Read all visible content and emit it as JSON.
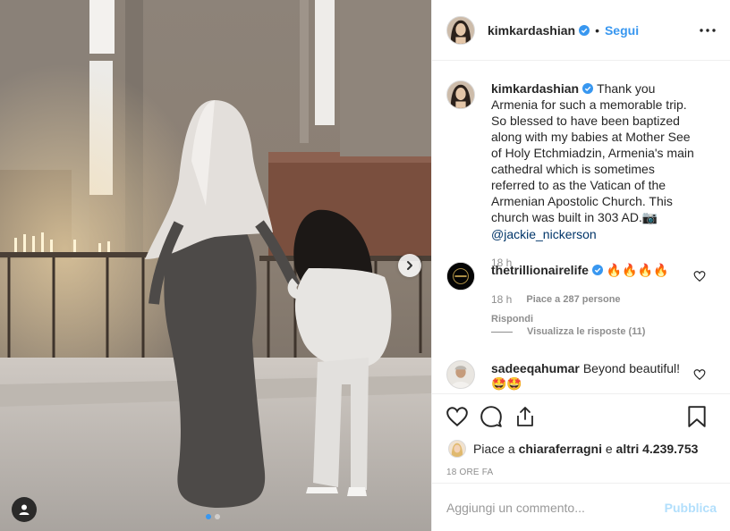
{
  "post": {
    "author": "kimkardashian",
    "separator": "•",
    "follow_label": "Segui",
    "carousel_total": 2,
    "carousel_active": 1
  },
  "caption": {
    "username": "kimkardashian",
    "text": "Thank you Armenia for such a memorable trip. So blessed to have been baptized along with my babies at Mother See of Holy Etchmiadzin, Armenia's main cathedral which is sometimes referred to as the Vatican of the Armenian Apostolic Church. This church was built in 303 AD.",
    "camera_emoji": "📷",
    "mention": "@jackie_nickerson",
    "time": "18 h"
  },
  "comments": [
    {
      "username": "thetrillionairelife",
      "text_emoji": "🔥🔥🔥🔥",
      "time": "18 h",
      "likes_text": "Piace a 287 persone",
      "reply_label": "Rispondi",
      "view_replies": "Visualizza le risposte (11)"
    },
    {
      "username": "sadeeqahumar",
      "text": "Beyond beautiful!",
      "text_emoji": "🤩🤩"
    }
  ],
  "likes": {
    "prefix": "Piace a",
    "user": "chiaraferragni",
    "middle": "e",
    "others": "altri 4.239.753"
  },
  "time_ago": "18 ORE FA",
  "add_comment": {
    "placeholder": "Aggiungi un commento...",
    "publish_label": "Pubblica"
  },
  "icons": [
    "heart-icon",
    "comment-icon",
    "share-icon",
    "bookmark-icon",
    "more-options-icon",
    "chevron-right-icon",
    "user-tag-icon",
    "verified-badge-icon"
  ],
  "colors": {
    "link_blue": "#3897f0",
    "publish_disabled": "#b2dffc",
    "text": "#262626",
    "secondary": "#8e8e8e"
  }
}
